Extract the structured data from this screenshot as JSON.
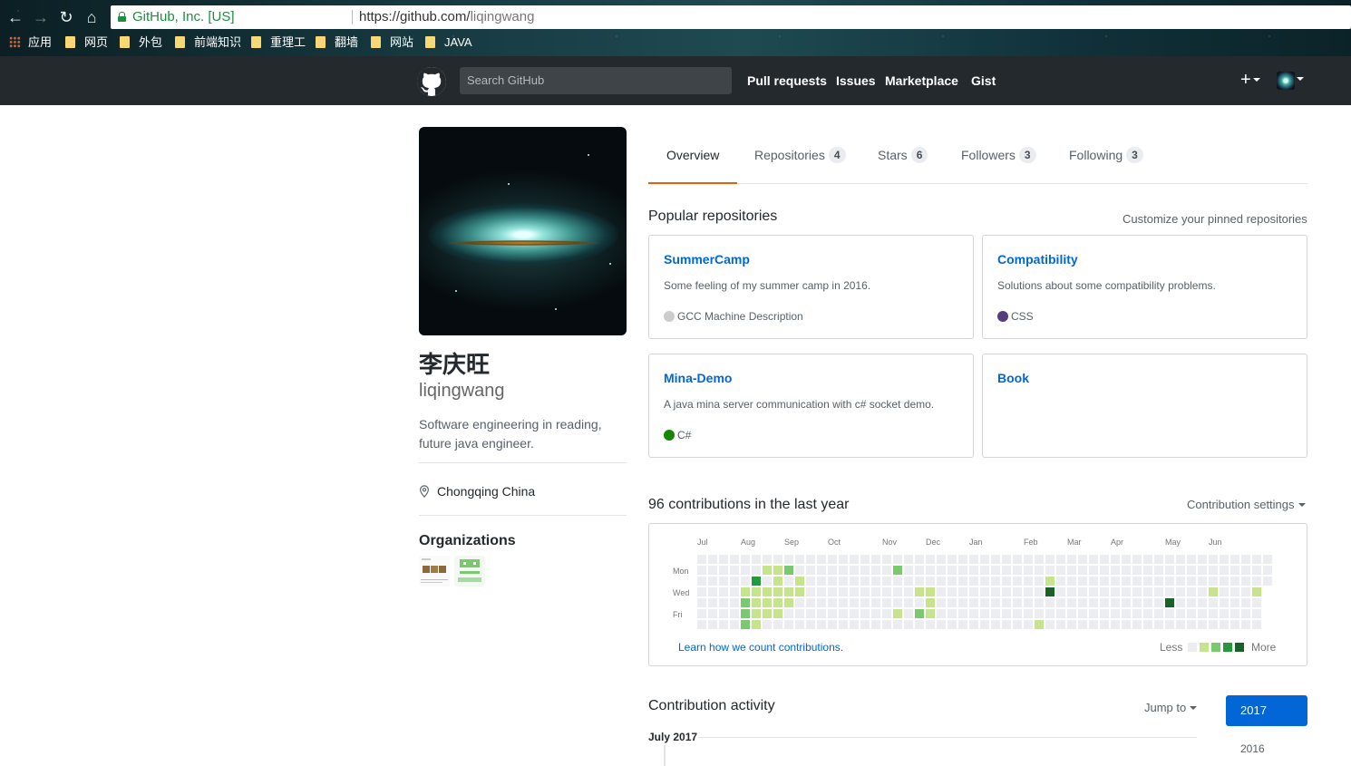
{
  "browser": {
    "back_icon": "arrow-left-icon",
    "forward_icon": "arrow-right-icon",
    "reload_icon": "reload-icon",
    "home_icon": "home-icon",
    "secure_org": "GitHub, Inc. [US]",
    "url_host": "https://github.com/",
    "url_path": "liqingwang",
    "bookmarks": [
      "应用",
      "网页",
      "外包",
      "前端知识",
      "重理工",
      "翻墙",
      "网站",
      "JAVA"
    ]
  },
  "header": {
    "search_placeholder": "Search GitHub",
    "nav": [
      "Pull requests",
      "Issues",
      "Marketplace",
      "Gist"
    ],
    "plus": "+"
  },
  "profile": {
    "name": "李庆旺",
    "login": "liqingwang",
    "bio": "Software engineering in reading, future java engineer.",
    "location": "Chongqing China",
    "organizations_title": "Organizations"
  },
  "tabs": [
    {
      "label": "Overview",
      "count": null
    },
    {
      "label": "Repositories",
      "count": "4"
    },
    {
      "label": "Stars",
      "count": "6"
    },
    {
      "label": "Followers",
      "count": "3"
    },
    {
      "label": "Following",
      "count": "3"
    }
  ],
  "pinned": {
    "title": "Popular repositories",
    "customize": "Customize your pinned repositories",
    "repos": [
      {
        "name": "SummerCamp",
        "desc": "Some feeling of my summer camp in 2016.",
        "lang": "GCC Machine Description",
        "lang_color": "#cccccc"
      },
      {
        "name": "Compatibility",
        "desc": "Solutions about some compatibility problems.",
        "lang": "CSS",
        "lang_color": "#563d7c"
      },
      {
        "name": "Mina-Demo",
        "desc": "A java mina server communication with c# socket demo.",
        "lang": "C#",
        "lang_color": "#178600"
      },
      {
        "name": "Book",
        "desc": "",
        "lang": "",
        "lang_color": ""
      }
    ]
  },
  "contributions": {
    "title": "96 contributions in the last year",
    "settings": "Contribution settings",
    "months": [
      "Jul",
      "Aug",
      "Sep",
      "Oct",
      "Nov",
      "Dec",
      "Jan",
      "Feb",
      "Mar",
      "Apr",
      "May",
      "Jun"
    ],
    "days": [
      "Mon",
      "Wed",
      "Fri"
    ],
    "learn": "Learn how we count contributions.",
    "less": "Less",
    "more": "More",
    "colors": [
      "#ebedf0",
      "#c6e48b",
      "#7bc96f",
      "#239a3b",
      "#196127"
    ]
  },
  "activity": {
    "title": "Contribution activity",
    "jump_to": "Jump to",
    "years": [
      "2017",
      "2016"
    ],
    "period": "July 2017"
  }
}
